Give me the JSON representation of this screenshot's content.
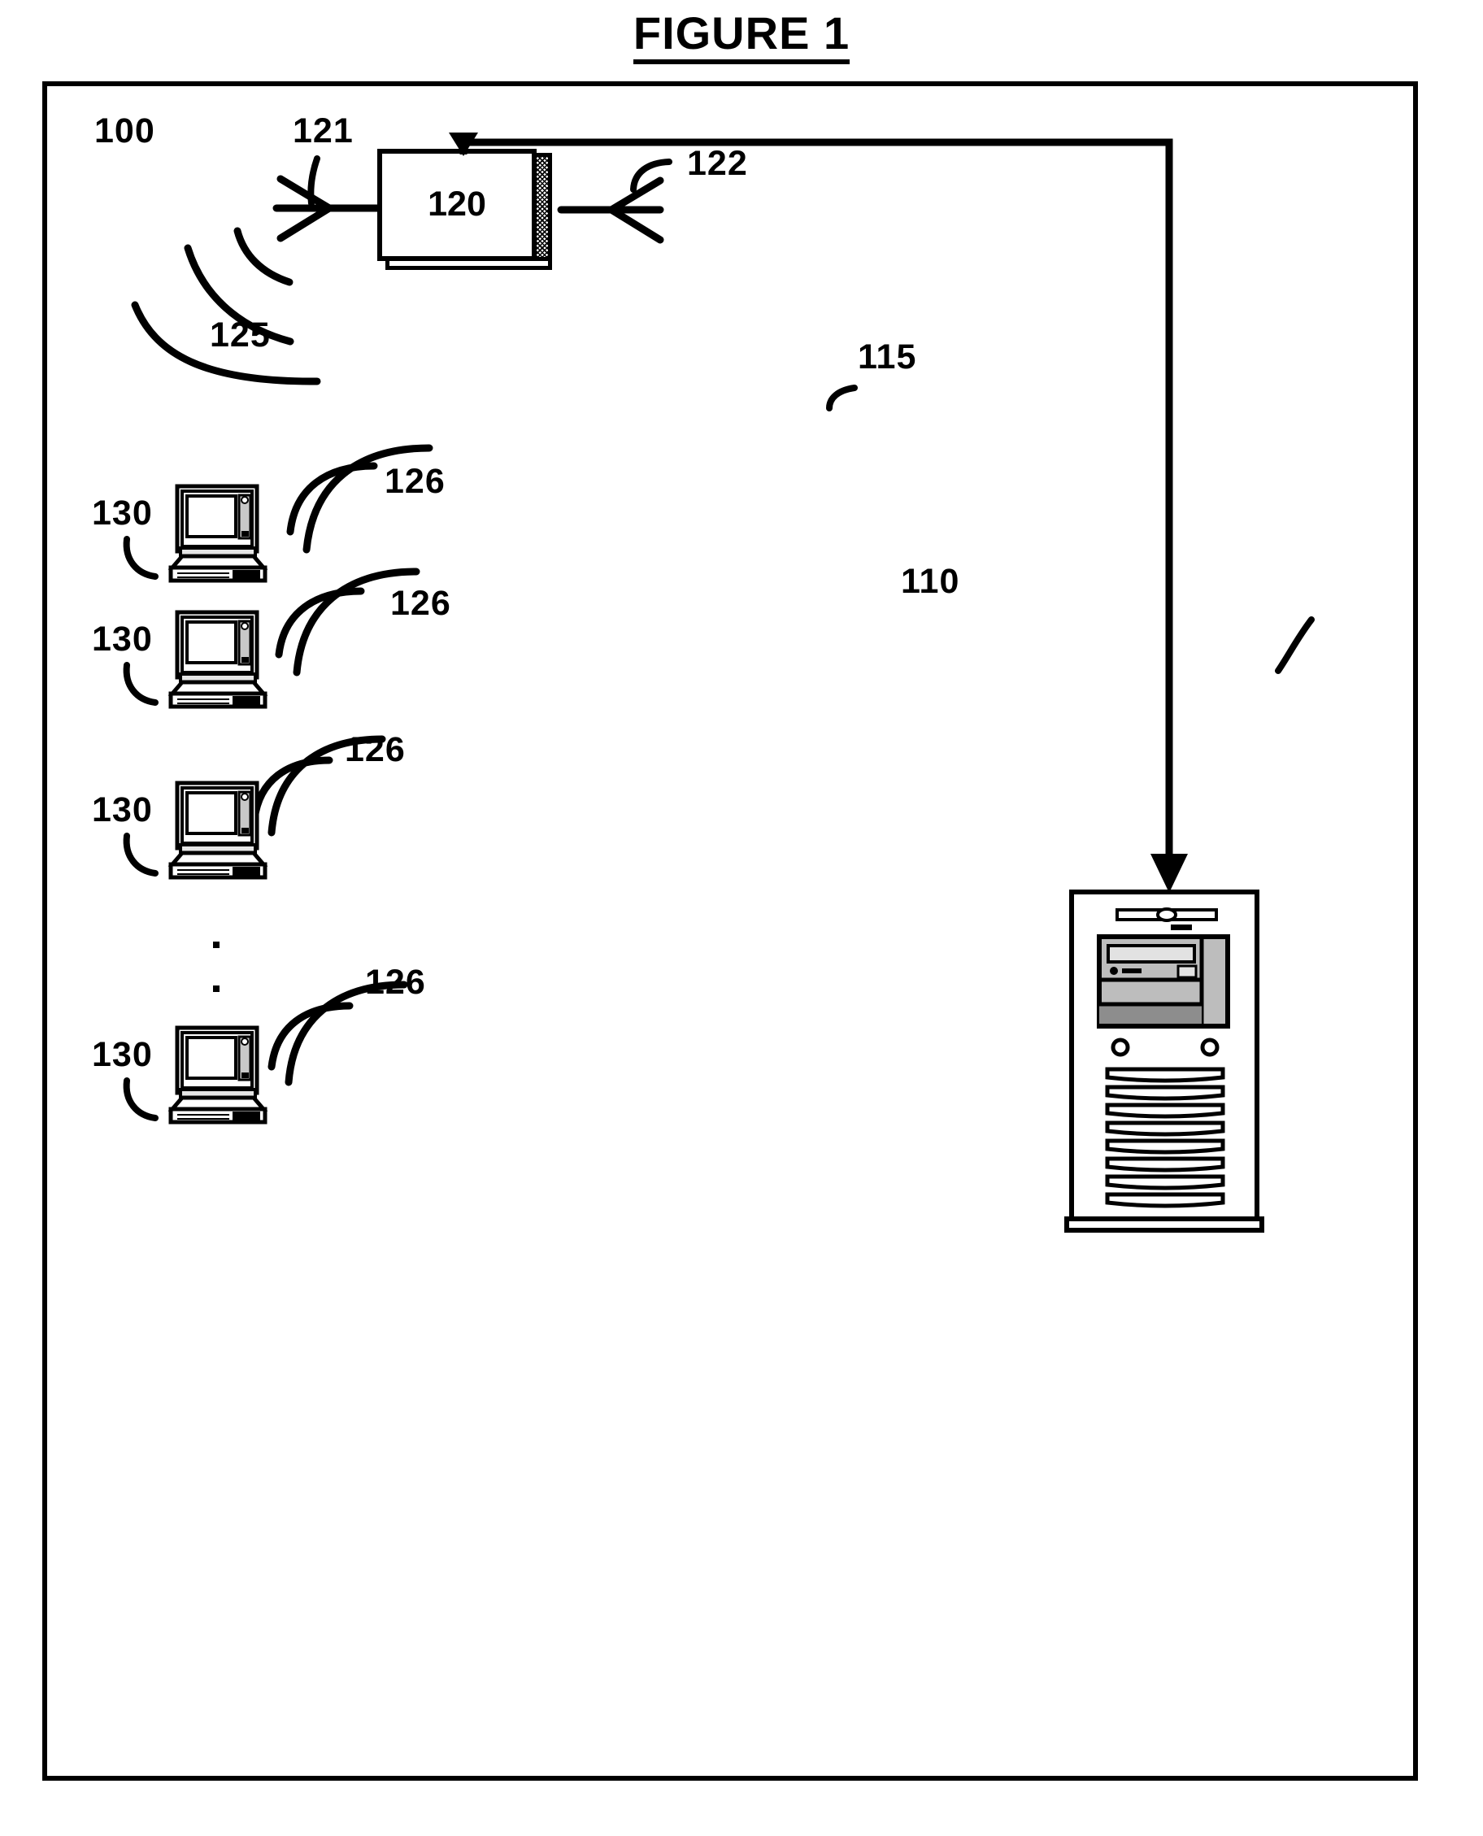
{
  "figure": {
    "title": "FIGURE 1"
  },
  "labels": {
    "system": "100",
    "server": "110",
    "link": "115",
    "base_station": "120",
    "antenna_left": "121",
    "antenna_right": "122",
    "wave_uplink": "125",
    "wave_client_1": "126",
    "wave_client_2": "126",
    "wave_client_3": "126",
    "wave_client_4": "126",
    "client_1": "130",
    "client_2": "130",
    "client_3": "130",
    "client_4": "130"
  },
  "icons": {
    "antenna_left": "antenna-icon",
    "antenna_right": "antenna-icon",
    "laptop": "laptop-icon",
    "server": "server-tower-icon",
    "radio_waves": "radio-wave-icon",
    "arrow_down": "arrow-down-icon",
    "ellipsis": "vertical-ellipsis-icon"
  },
  "colors": {
    "ink": "#000000",
    "paper": "#ffffff"
  }
}
